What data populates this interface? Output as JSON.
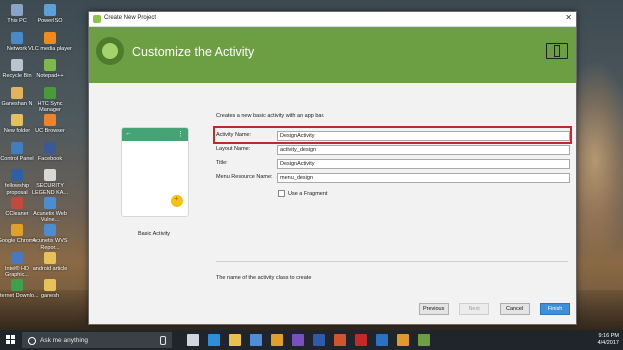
{
  "desktop": {
    "icons": [
      {
        "label": "This PC",
        "color": "#8aa4c8"
      },
      {
        "label": "Network",
        "color": "#4a89c8"
      },
      {
        "label": "Recycle Bin",
        "color": "#b8c4d0"
      },
      {
        "label": "Ganeshan N",
        "color": "#e2b35a"
      },
      {
        "label": "New folder",
        "color": "#e5c15e"
      },
      {
        "label": "Control Panel",
        "color": "#3f7fc0"
      },
      {
        "label": "fellowship proposal",
        "color": "#2f5fa5"
      },
      {
        "label": "CCleaner",
        "color": "#c24a3a"
      },
      {
        "label": "Google Chrome",
        "color": "#e0a02a"
      },
      {
        "label": "Intel® HD Graphic...",
        "color": "#4778c6"
      },
      {
        "label": "Internet Downlo...",
        "color": "#3ea04e"
      },
      {
        "label": "PowerISO",
        "color": "#5da0d8"
      },
      {
        "label": "VLC media player",
        "color": "#f08a1c"
      },
      {
        "label": "Notepad++",
        "color": "#7dba4a"
      },
      {
        "label": "HTC Sync Manager",
        "color": "#4a9a3c"
      },
      {
        "label": "UC Browser",
        "color": "#f0822a"
      },
      {
        "label": "Facebook",
        "color": "#3b5998"
      },
      {
        "label": "SECURITY LEGEND KA...",
        "color": "#d8d8d8"
      },
      {
        "label": "Acunetix Web Vulne...",
        "color": "#4c8dd0"
      },
      {
        "label": "Acunetix WVS Repor...",
        "color": "#4c8dd0"
      },
      {
        "label": "android article",
        "color": "#e6c35a"
      },
      {
        "label": "ganesh",
        "color": "#e6c35a"
      }
    ]
  },
  "dialog": {
    "window_title": "Create New Project",
    "close_glyph": "✕",
    "header_title": "Customize the Activity",
    "intro": "Creates a new basic activity with an app bar.",
    "preview": {
      "back_glyph": "←",
      "menu_glyph": "⋮",
      "label": "Basic Activity"
    },
    "fields": {
      "activity_name": {
        "label": "Activity Name:",
        "value": "DesignActivity"
      },
      "layout_name": {
        "label": "Layout Name:",
        "value": "activity_design"
      },
      "title": {
        "label": "Title:",
        "value": "DesignActivity"
      },
      "menu_resource": {
        "label": "Menu Resource Name:",
        "value": "menu_design"
      }
    },
    "use_fragment": {
      "label": "Use a Fragment",
      "checked": false
    },
    "hint": "The name of the activity class to create",
    "buttons": {
      "previous": "Previous",
      "next": "Next",
      "cancel": "Cancel",
      "finish": "Finish"
    }
  },
  "taskbar": {
    "search_placeholder": "Ask me anything",
    "pinned": [
      {
        "name": "task-view",
        "color": "#cfd6de"
      },
      {
        "name": "edge",
        "color": "#2f8ed8"
      },
      {
        "name": "file-explorer",
        "color": "#e8c04a"
      },
      {
        "name": "store",
        "color": "#4f8dd8"
      },
      {
        "name": "chrome",
        "color": "#e0a02a"
      },
      {
        "name": "visual-studio",
        "color": "#7a4fc0"
      },
      {
        "name": "word",
        "color": "#2d5ba8"
      },
      {
        "name": "powerpoint",
        "color": "#d0542c"
      },
      {
        "name": "pdf",
        "color": "#c62828"
      },
      {
        "name": "outlook",
        "color": "#2a73c4"
      },
      {
        "name": "photoshop-like",
        "color": "#e09a2a"
      },
      {
        "name": "android-studio",
        "color": "#6c9e43"
      }
    ],
    "time": "9:16 PM",
    "date": "4/4/2017"
  },
  "colors": {
    "header_green": "#6c9e43",
    "highlight_red": "#c62828",
    "finish_blue": "#3c8fd8"
  }
}
